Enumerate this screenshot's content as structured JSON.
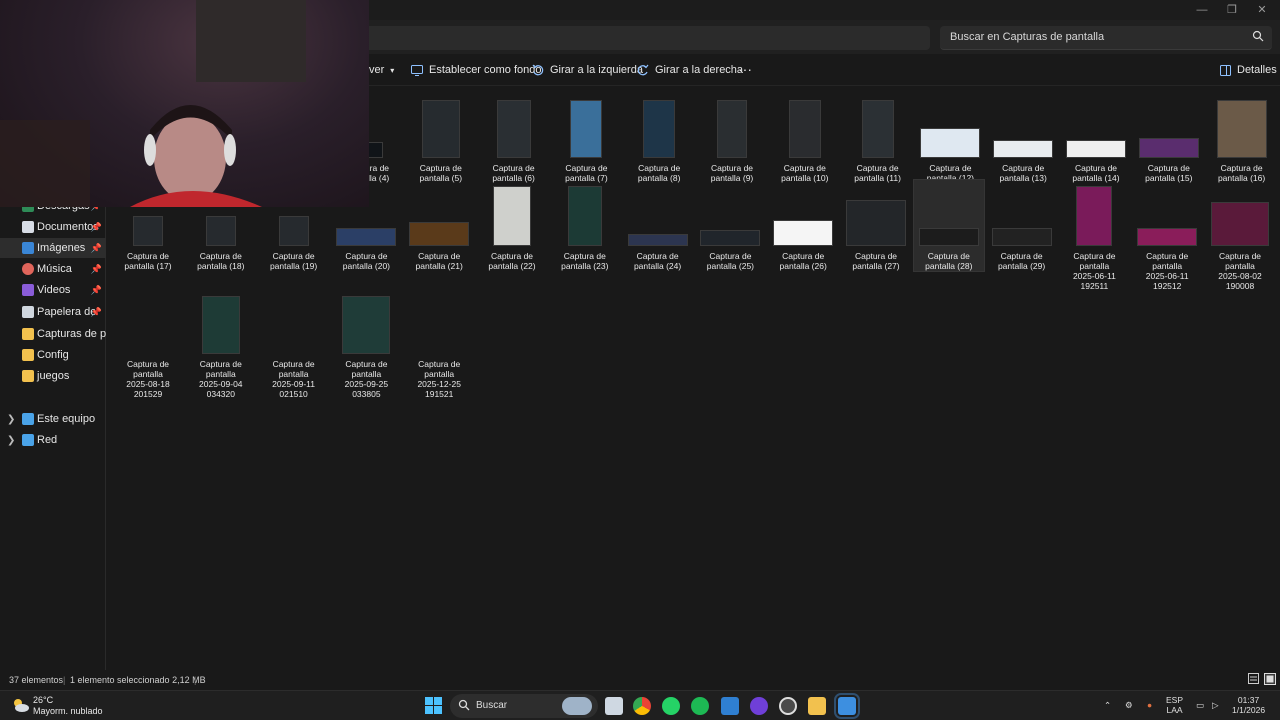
{
  "search": {
    "placeholder": "Buscar en Capturas de pantalla"
  },
  "toolbar": {
    "partial_label": "ver",
    "set_background": "Establecer como fondo",
    "rotate_left": "Girar a la izquierda",
    "rotate_right": "Girar a la derecha",
    "more": "···",
    "details": "Detalles"
  },
  "nav": {
    "items": [
      {
        "label": "Descargas",
        "icon": "download-icon",
        "pinned": true
      },
      {
        "label": "Documentos",
        "icon": "document-icon",
        "pinned": true
      },
      {
        "label": "Imágenes",
        "icon": "image-icon",
        "pinned": true,
        "selected": true
      },
      {
        "label": "Música",
        "icon": "music-icon",
        "pinned": true
      },
      {
        "label": "Videos",
        "icon": "video-icon",
        "pinned": true
      },
      {
        "label": "Papelera de reciclaje",
        "icon": "recycle-bin-icon",
        "pinned": true
      },
      {
        "label": "Capturas de pantalla",
        "icon": "folder-icon",
        "pinned": false
      },
      {
        "label": "Config",
        "icon": "folder-icon",
        "pinned": false
      },
      {
        "label": "juegos",
        "icon": "folder-icon",
        "pinned": false
      }
    ],
    "sections": [
      {
        "label": "Este equipo",
        "icon": "pc-icon"
      },
      {
        "label": "Red",
        "icon": "network-icon"
      }
    ]
  },
  "files": [
    {
      "name": "Captura de pantalla (4)",
      "l1": "Captura de",
      "l2": "pantalla (4)"
    },
    {
      "name": "Captura de pantalla (5)",
      "l1": "Captura de",
      "l2": "pantalla (5)"
    },
    {
      "name": "Captura de pantalla (6)",
      "l1": "Captura de",
      "l2": "pantalla (6)"
    },
    {
      "name": "Captura de pantalla (7)",
      "l1": "Captura de",
      "l2": "pantalla (7)"
    },
    {
      "name": "Captura de pantalla (8)",
      "l1": "Captura de",
      "l2": "pantalla (8)"
    },
    {
      "name": "Captura de pantalla (9)",
      "l1": "Captura de",
      "l2": "pantalla (9)"
    },
    {
      "name": "Captura de pantalla (10)",
      "l1": "Captura de",
      "l2": "pantalla (10)"
    },
    {
      "name": "Captura de pantalla (11)",
      "l1": "Captura de",
      "l2": "pantalla (11)"
    },
    {
      "name": "Captura de pantalla (12)",
      "l1": "Captura de",
      "l2": "pantalla (12)"
    },
    {
      "name": "Captura de pantalla (13)",
      "l1": "Captura de",
      "l2": "pantalla (13)"
    },
    {
      "name": "Captura de pantalla (14)",
      "l1": "Captura de",
      "l2": "pantalla (14)"
    },
    {
      "name": "Captura de pantalla (15)",
      "l1": "Captura de",
      "l2": "pantalla (15)"
    },
    {
      "name": "Captura de pantalla (16)",
      "l1": "Captura de",
      "l2": "pantalla (16)"
    },
    {
      "name": "Captura de pantalla (17)",
      "l1": "Captura de",
      "l2": "pantalla (17)"
    },
    {
      "name": "Captura de pantalla (18)",
      "l1": "Captura de",
      "l2": "pantalla (18)"
    },
    {
      "name": "Captura de pantalla (19)",
      "l1": "Captura de",
      "l2": "pantalla (19)"
    },
    {
      "name": "Captura de pantalla (20)",
      "l1": "Captura de",
      "l2": "pantalla (20)"
    },
    {
      "name": "Captura de pantalla (21)",
      "l1": "Captura de",
      "l2": "pantalla (21)"
    },
    {
      "name": "Captura de pantalla (22)",
      "l1": "Captura de",
      "l2": "pantalla (22)"
    },
    {
      "name": "Captura de pantalla (23)",
      "l1": "Captura de",
      "l2": "pantalla (23)"
    },
    {
      "name": "Captura de pantalla (24)",
      "l1": "Captura de",
      "l2": "pantalla (24)"
    },
    {
      "name": "Captura de pantalla (25)",
      "l1": "Captura de",
      "l2": "pantalla (25)"
    },
    {
      "name": "Captura de pantalla (26)",
      "l1": "Captura de",
      "l2": "pantalla (26)"
    },
    {
      "name": "Captura de pantalla (27)",
      "l1": "Captura de",
      "l2": "pantalla (27)"
    },
    {
      "name": "Captura de pantalla (28)",
      "l1": "Captura de",
      "l2": "pantalla (28)",
      "selected": true
    },
    {
      "name": "Captura de pantalla (29)",
      "l1": "Captura de",
      "l2": "pantalla (29)"
    },
    {
      "name": "Captura de pantalla 2025-06-11 192511",
      "l1": "Captura de",
      "l2": "pantalla",
      "l3": "2025-06-11",
      "l4": "192511"
    },
    {
      "name": "Captura de pantalla 2025-06-11 192512",
      "l1": "Captura de",
      "l2": "pantalla",
      "l3": "2025-06-11",
      "l4": "192512"
    },
    {
      "name": "Captura de pantalla 2025-08-02 190008",
      "l1": "Captura de",
      "l2": "pantalla",
      "l3": "2025-08-02",
      "l4": "190008"
    },
    {
      "name": "Captura de pantalla 2025-08-18 201529",
      "l1": "Captura de",
      "l2": "pantalla",
      "l3": "2025-08-18",
      "l4": "201529"
    },
    {
      "name": "Captura de pantalla 2025-09-04 034320",
      "l1": "Captura de",
      "l2": "pantalla",
      "l3": "2025-09-04",
      "l4": "034320"
    },
    {
      "name": "Captura de pantalla 2025-09-11 021510",
      "l1": "Captura de",
      "l2": "pantalla",
      "l3": "2025-09-11",
      "l4": "021510"
    },
    {
      "name": "Captura de pantalla 2025-09-25 033805",
      "l1": "Captura de",
      "l2": "pantalla",
      "l3": "2025-09-25",
      "l4": "033805"
    },
    {
      "name": "Captura de pantalla 2025-12-25 191521",
      "l1": "Captura de",
      "l2": "pantalla",
      "l3": "2025-12-25",
      "l4": "191521"
    }
  ],
  "status": {
    "count": "37 elementos",
    "selection": "1 elemento seleccionado  2,12 MB"
  },
  "taskbar": {
    "weather_temp": "26°C",
    "weather_desc": "Mayorm. nublado",
    "search_label": "Buscar",
    "lang_1": "ESP",
    "lang_2": "LAA",
    "time": "01:37",
    "date": "1/1/2026"
  },
  "colors": {
    "accent": "#4cc2ff",
    "folder": "#f2c14e",
    "selected_bg": "#2d2d2d"
  }
}
